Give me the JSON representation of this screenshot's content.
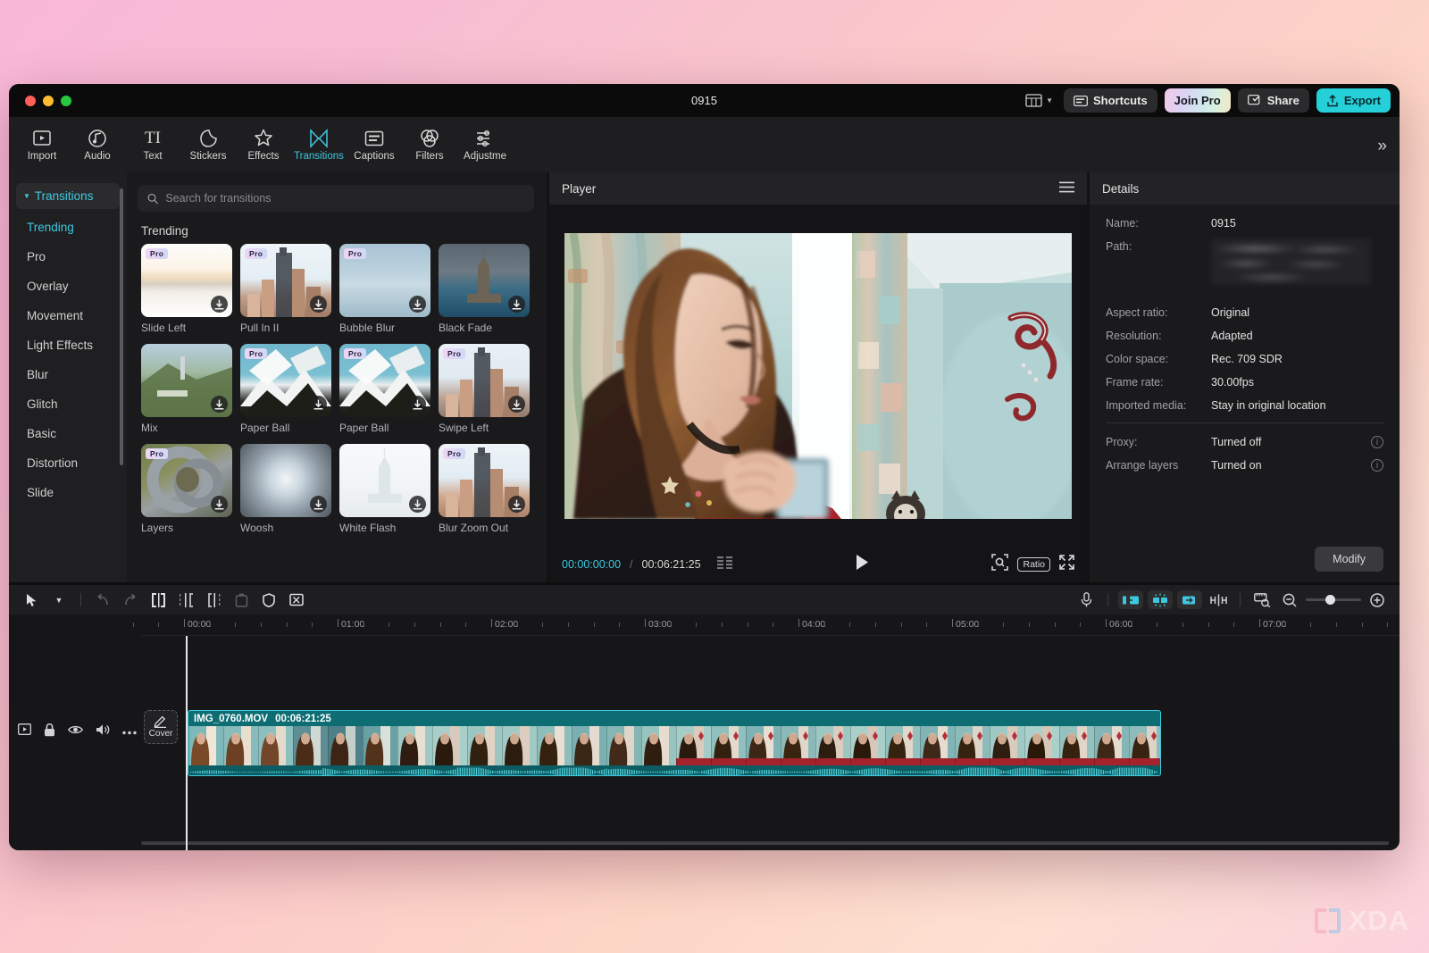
{
  "window": {
    "title": "0915"
  },
  "titlebar": {
    "layout_icon": "layout-icon",
    "shortcuts_label": "Shortcuts",
    "join_pro_label": "Join Pro",
    "share_label": "Share",
    "export_label": "Export"
  },
  "toolbar": {
    "tabs": [
      {
        "label": "Import",
        "icon": "import-icon",
        "active": false
      },
      {
        "label": "Audio",
        "icon": "audio-icon",
        "active": false
      },
      {
        "label": "Text",
        "icon": "text-icon",
        "active": false
      },
      {
        "label": "Stickers",
        "icon": "stickers-icon",
        "active": false
      },
      {
        "label": "Effects",
        "icon": "effects-icon",
        "active": false
      },
      {
        "label": "Transitions",
        "icon": "transitions-icon",
        "active": true
      },
      {
        "label": "Captions",
        "icon": "captions-icon",
        "active": false
      },
      {
        "label": "Filters",
        "icon": "filters-icon",
        "active": false
      },
      {
        "label": "Adjustme",
        "icon": "adjustment-icon",
        "active": false
      }
    ],
    "overflow_icon": "chevron-double-right-icon"
  },
  "library": {
    "group_title": "Transitions",
    "categories": [
      "Trending",
      "Pro",
      "Overlay",
      "Movement",
      "Light Effects",
      "Blur",
      "Glitch",
      "Basic",
      "Distortion",
      "Slide"
    ],
    "selected_category": "Trending",
    "search_placeholder": "Search for transitions",
    "search_value": "",
    "section_title": "Trending",
    "pro_badge": "Pro",
    "items": [
      {
        "name": "Slide Left",
        "pro": true,
        "thumb": "motionblur-sunset"
      },
      {
        "name": "Pull In II",
        "pro": true,
        "thumb": "skyscraper"
      },
      {
        "name": "Bubble Blur",
        "pro": true,
        "thumb": "blurred-boat"
      },
      {
        "name": "Black Fade",
        "pro": false,
        "thumb": "maidens-tower"
      },
      {
        "name": "Mix",
        "pro": false,
        "thumb": "hollywood-hill"
      },
      {
        "name": "Paper Ball",
        "pro": true,
        "thumb": "paper-mountain"
      },
      {
        "name": "Paper Ball",
        "pro": true,
        "thumb": "paper-mountain"
      },
      {
        "name": "Swipe Left",
        "pro": true,
        "thumb": "city-hazy"
      },
      {
        "name": "Layers",
        "pro": true,
        "thumb": "grey-rings"
      },
      {
        "name": "Woosh",
        "pro": false,
        "thumb": "radial-blur"
      },
      {
        "name": "White Flash",
        "pro": false,
        "thumb": "white-tower"
      },
      {
        "name": "Blur Zoom Out",
        "pro": true,
        "thumb": "city-tower"
      }
    ]
  },
  "player": {
    "title": "Player",
    "menu_icon": "hamburger-icon",
    "current_time": "00:00:00:00",
    "separator": "/",
    "total_time": "00:06:21:25",
    "quality_icon": "quality-icon",
    "play_icon": "play-icon",
    "snapshot_icon": "snapshot-icon",
    "ratio_label": "Ratio",
    "fullscreen_icon": "fullscreen-icon"
  },
  "details": {
    "title": "Details",
    "rows": [
      {
        "key": "Name:",
        "value": "0915",
        "info": false,
        "blurred": false
      },
      {
        "key": "Path:",
        "value": "",
        "info": false,
        "blurred": true
      },
      {
        "key": "Aspect ratio:",
        "value": "Original",
        "info": false,
        "blurred": false
      },
      {
        "key": "Resolution:",
        "value": "Adapted",
        "info": false,
        "blurred": false
      },
      {
        "key": "Color space:",
        "value": "Rec. 709 SDR",
        "info": false,
        "blurred": false
      },
      {
        "key": "Frame rate:",
        "value": "30.00fps",
        "info": false,
        "blurred": false
      },
      {
        "key": "Imported media:",
        "value": "Stay in original location",
        "info": false,
        "blurred": false
      }
    ],
    "rows2": [
      {
        "key": "Proxy:",
        "value": "Turned off",
        "info": true
      },
      {
        "key": "Arrange layers",
        "value": "Turned on",
        "info": true
      }
    ],
    "modify_label": "Modify"
  },
  "timeline": {
    "tools": [
      {
        "icon": "cursor-icon",
        "dim": false
      },
      {
        "icon": "chevron-down-icon",
        "dim": false
      },
      {
        "icon": "undo-icon",
        "dim": true
      },
      {
        "icon": "redo-icon",
        "dim": true
      },
      {
        "icon": "split-icon",
        "dim": false
      },
      {
        "icon": "trim-left-icon",
        "dim": false
      },
      {
        "icon": "trim-right-icon",
        "dim": false
      },
      {
        "icon": "delete-icon",
        "dim": true
      },
      {
        "icon": "shield-icon",
        "dim": false
      },
      {
        "icon": "crop-icon",
        "dim": false
      }
    ],
    "right_tools": [
      {
        "icon": "microphone-icon",
        "chip": false,
        "active": false
      },
      {
        "icon": "insert-left-icon",
        "chip": true,
        "active": true
      },
      {
        "icon": "auto-sync-icon",
        "chip": true,
        "active": true
      },
      {
        "icon": "insert-right-icon",
        "chip": true,
        "active": true
      },
      {
        "icon": "keyframe-icon",
        "chip": false,
        "active": false
      },
      {
        "icon": "measure-icon",
        "chip": false,
        "active": false
      },
      {
        "icon": "zoom-out-icon",
        "chip": false,
        "active": false
      }
    ],
    "zoom_in_icon": "zoom-in-icon",
    "ruler_labels": [
      "00:00",
      "01:00",
      "02:00",
      "03:00",
      "04:00",
      "05:00",
      "06:00",
      "07:00"
    ],
    "track_icons": [
      "track-preview-icon",
      "lock-icon",
      "eye-icon",
      "volume-icon",
      "more-icon"
    ],
    "cover_label": "Cover",
    "cover_icon": "pencil-icon",
    "clip": {
      "name": "IMG_0760.MOV",
      "duration": "00:06:21:25"
    },
    "playhead_time": "00:00:00:00"
  },
  "watermark": {
    "text": "XDA"
  },
  "colors": {
    "accent": "#3ec8e0",
    "export": "#25d0d8",
    "clip": "#0e6d73",
    "window_bg": "#141414",
    "panel_bg": "#1a1a1c"
  }
}
